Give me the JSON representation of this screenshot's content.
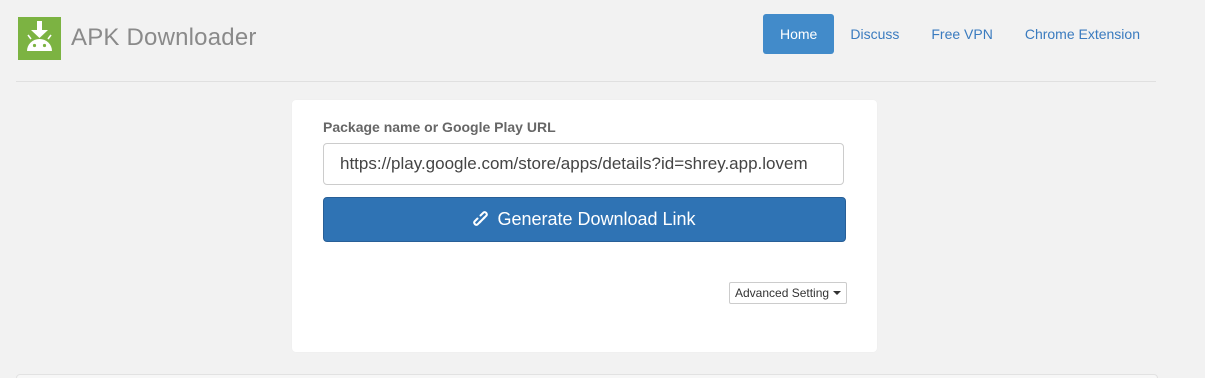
{
  "brand": {
    "title": "APK Downloader",
    "logo_icon": "android-download-icon",
    "logo_color": "#7cb342"
  },
  "nav": {
    "items": [
      {
        "label": "Home",
        "active": true
      },
      {
        "label": "Discuss",
        "active": false
      },
      {
        "label": "Free VPN",
        "active": false
      },
      {
        "label": "Chrome Extension",
        "active": false
      }
    ],
    "active_color": "#428bca",
    "link_color": "#3a7bbf"
  },
  "form": {
    "label": "Package name or Google Play URL",
    "url_value": "https://play.google.com/store/apps/details?id=shrey.app.lovem",
    "generate_label": "Generate Download Link",
    "generate_icon": "link-icon",
    "button_color": "#2f73b4",
    "advanced_label": "Advanced Setting",
    "advanced_icon": "caret-down-icon"
  }
}
